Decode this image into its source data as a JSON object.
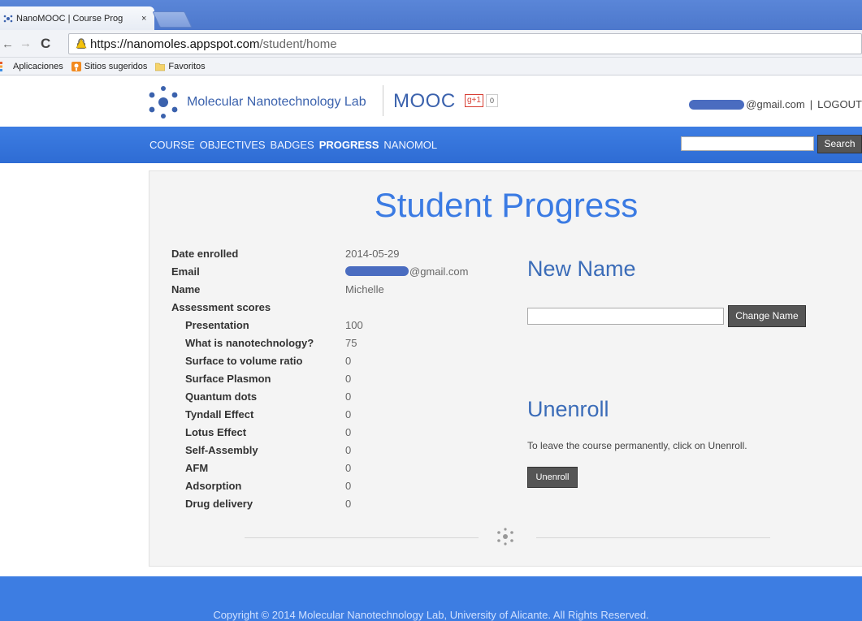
{
  "browser": {
    "tab_title": "NanoMOOC | Course Prog",
    "tab_close": "×",
    "url_scheme": "https://",
    "url_host": "nanomoles.appspot.com",
    "url_path": "/student/home",
    "bookmarks": [
      {
        "label": "Aplicaciones"
      },
      {
        "label": "Sitios sugeridos"
      },
      {
        "label": "Favoritos"
      }
    ]
  },
  "header": {
    "brand": "Molecular Nanotechnology Lab",
    "product": "MOOC",
    "gplus_label": "g+1",
    "gplus_count": "0",
    "account_email_suffix": "@gmail.com",
    "separator": "|",
    "logout": "LOGOUT"
  },
  "nav": {
    "items": [
      {
        "label": "COURSE"
      },
      {
        "label": "OBJECTIVES"
      },
      {
        "label": "BADGES"
      },
      {
        "label": "PROGRESS"
      },
      {
        "label": "NANOMOL"
      }
    ],
    "active": "PROGRESS",
    "search_label": "Search"
  },
  "main": {
    "title": "Student Progress",
    "date_enrolled_label": "Date enrolled",
    "date_enrolled": "2014-05-29",
    "email_label": "Email",
    "email_suffix": "@gmail.com",
    "name_label": "Name",
    "name": "Michelle",
    "assessment_label": "Assessment scores",
    "scores": [
      {
        "label": "Presentation",
        "value": "100"
      },
      {
        "label": "What is nanotechnology?",
        "value": "75"
      },
      {
        "label": "Surface to volume ratio",
        "value": "0"
      },
      {
        "label": "Surface Plasmon",
        "value": "0"
      },
      {
        "label": "Quantum dots",
        "value": "0"
      },
      {
        "label": "Tyndall Effect",
        "value": "0"
      },
      {
        "label": "Lotus Effect",
        "value": "0"
      },
      {
        "label": "Self-Assembly",
        "value": "0"
      },
      {
        "label": "AFM",
        "value": "0"
      },
      {
        "label": "Adsorption",
        "value": "0"
      },
      {
        "label": "Drug delivery",
        "value": "0"
      }
    ],
    "new_name_title": "New Name",
    "change_name_label": "Change Name",
    "unenroll_title": "Unenroll",
    "unenroll_text": "To leave the course permanently, click on Unenroll.",
    "unenroll_button": "Unenroll"
  },
  "footer": {
    "copyright": "Copyright © 2014 Molecular Nanotechnology Lab, University of Alicante. All Rights Reserved."
  },
  "colors": {
    "brand_blue": "#3b7be3",
    "nav_blue": "#2e6cd4",
    "button_gray": "#555555"
  }
}
